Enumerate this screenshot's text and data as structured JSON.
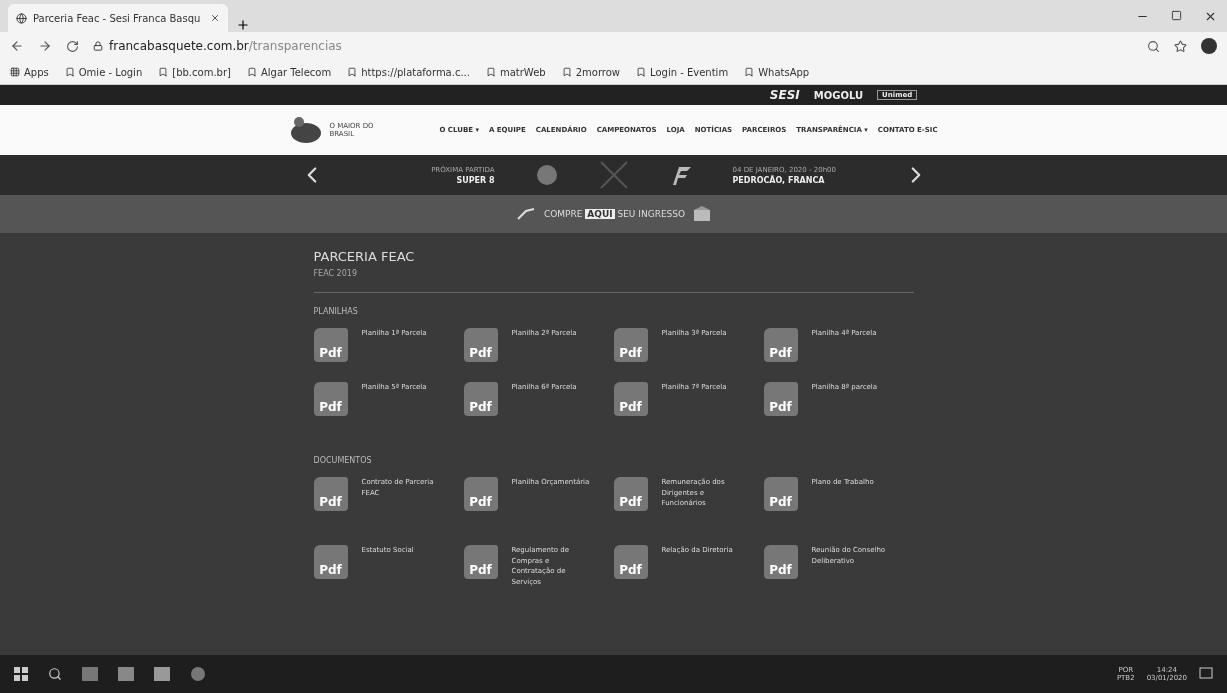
{
  "browser": {
    "tab": {
      "title": "Parceria Feac - Sesi Franca Basqu",
      "selected": true
    },
    "url_host": "francabasquete.com.br",
    "url_path": "/transparencias",
    "bookmarks": [
      "Apps",
      "Omie - Login",
      "[bb.com.br]",
      "Algar Telecom",
      "https://plataforma.c...",
      "matrWeb",
      "2morrow",
      "Login - Eventim",
      "WhatsApp"
    ]
  },
  "sponsors": [
    "SESI",
    "MOGOLU",
    "Unimed"
  ],
  "header": {
    "logo_text": "O MAIOR DO BRASIL",
    "nav": [
      "O CLUBE ▾",
      "A EQUIPE",
      "CALENDÁRIO",
      "CAMPEONATOS",
      "LOJA",
      "NOTÍCIAS",
      "PARCEIROS",
      "TRANSPARÊNCIA ▾",
      "CONTATO E-SIC"
    ]
  },
  "game": {
    "label": "PRÓXIMA PARTIDA",
    "competition": "SUPER 8",
    "date": "04 DE JANEIRO, 2020 - 20h00",
    "venue": "PEDROCÃO, FRANCA"
  },
  "ticket": {
    "before": "COMPRE",
    "highlight": "AQUI",
    "after": "SEU INGRESSO"
  },
  "page": {
    "title": "PARCERIA FEAC",
    "subtitle": "FEAC 2019",
    "sections": [
      {
        "title": "PLANILHAS",
        "files": [
          {
            "name": "Planilha 1ª Parcela",
            "icon_label": "Pdf"
          },
          {
            "name": "Planilha 2ª Parcela",
            "icon_label": "Pdf"
          },
          {
            "name": "Planilha 3ª Parcela",
            "icon_label": "Pdf"
          },
          {
            "name": "Planilha 4ª Parcela",
            "icon_label": "Pdf"
          },
          {
            "name": "Planilha 5ª Parcela",
            "icon_label": "Pdf"
          },
          {
            "name": "Planilha 6ª Parcela",
            "icon_label": "Pdf"
          },
          {
            "name": "Planilha 7ª Parcela",
            "icon_label": "Pdf"
          },
          {
            "name": "Planilha 8ª parcela",
            "icon_label": "Pdf"
          }
        ]
      },
      {
        "title": "DOCUMENTOS",
        "files": [
          {
            "name": "Contrato de Parceria FEAC",
            "icon_label": "Pdf"
          },
          {
            "name": "Planilha Orçamentária",
            "icon_label": "Pdf"
          },
          {
            "name": "Remuneração dos Dirigentes e Funcionários",
            "icon_label": "Pdf"
          },
          {
            "name": "Plano de Trabalho",
            "icon_label": "Pdf"
          },
          {
            "name": "Estatuto Social",
            "icon_label": "Pdf"
          },
          {
            "name": "Regulamento de Compras e Contratação de Serviços",
            "icon_label": "Pdf"
          },
          {
            "name": "Relação da Diretoria",
            "icon_label": "Pdf"
          },
          {
            "name": "Reunião do Conselho Deliberativo",
            "icon_label": "Pdf"
          }
        ]
      }
    ]
  },
  "taskbar": {
    "lang": "POR",
    "layout": "PTB2",
    "time": "14:24",
    "date": "03/01/2020"
  }
}
